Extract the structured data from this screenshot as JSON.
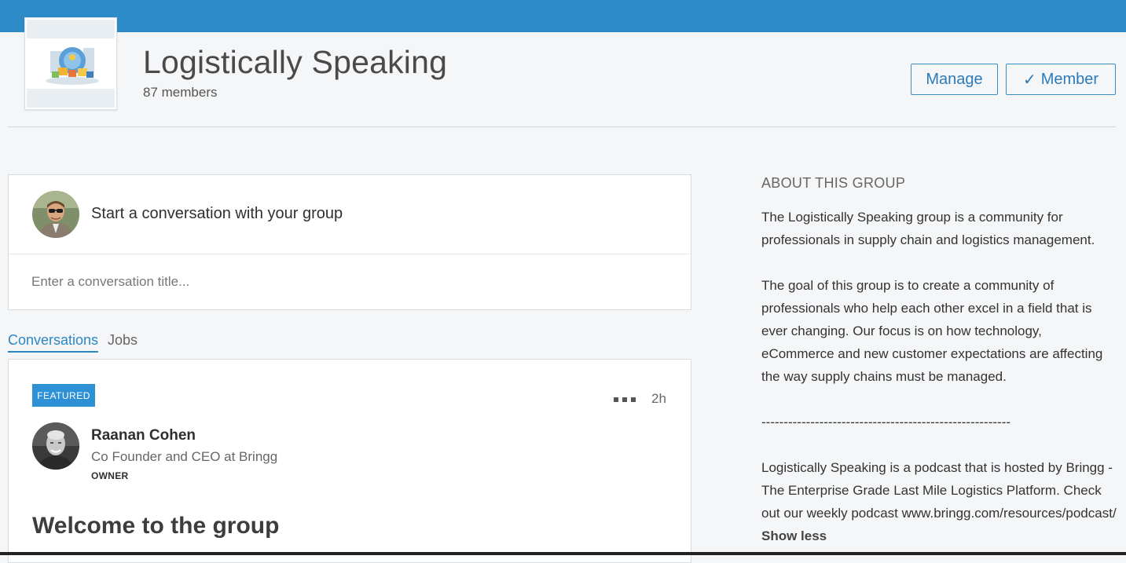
{
  "group": {
    "name": "Logistically Speaking",
    "member_count": "87 members"
  },
  "header_actions": {
    "manage_label": "Manage",
    "member_check": "✓",
    "member_label": "Member"
  },
  "composer": {
    "prompt": "Start a conversation with your group",
    "title_placeholder": "Enter a conversation title..."
  },
  "tabs": [
    {
      "label": "Conversations",
      "active": true
    },
    {
      "label": "Jobs",
      "active": false
    }
  ],
  "post": {
    "badge": "FEATURED",
    "timestamp": "2h",
    "author_name": "Raanan Cohen",
    "author_headline": "Co Founder and CEO at Bringg",
    "author_role": "OWNER",
    "title": "Welcome to the group"
  },
  "about": {
    "heading": "ABOUT THIS GROUP",
    "paragraph_1": "The Logistically Speaking group is a community for professionals in supply chain and logistics management.",
    "paragraph_2": "The goal of this group is to create a community of professionals who help each other excel in a field that is ever changing. Our focus is on how technology, eCommerce and new customer expectations are affecting the way supply chains must be managed.",
    "separator": "--------------------------------------------------------",
    "paragraph_3": "Logistically Speaking is a podcast that is hosted by Bringg - The Enterprise Grade Last Mile Logistics Platform. Check out our weekly podcast www.bringg.com/resources/podcast/",
    "show_less": "Show less"
  },
  "colors": {
    "top_bar": "#2d8cc8",
    "accent": "#2b87c6",
    "featured_badge": "#2e91d6",
    "page_background": "#f4f6f8"
  },
  "icons": {
    "more": "more-horizontal-icon",
    "check": "check-icon"
  }
}
